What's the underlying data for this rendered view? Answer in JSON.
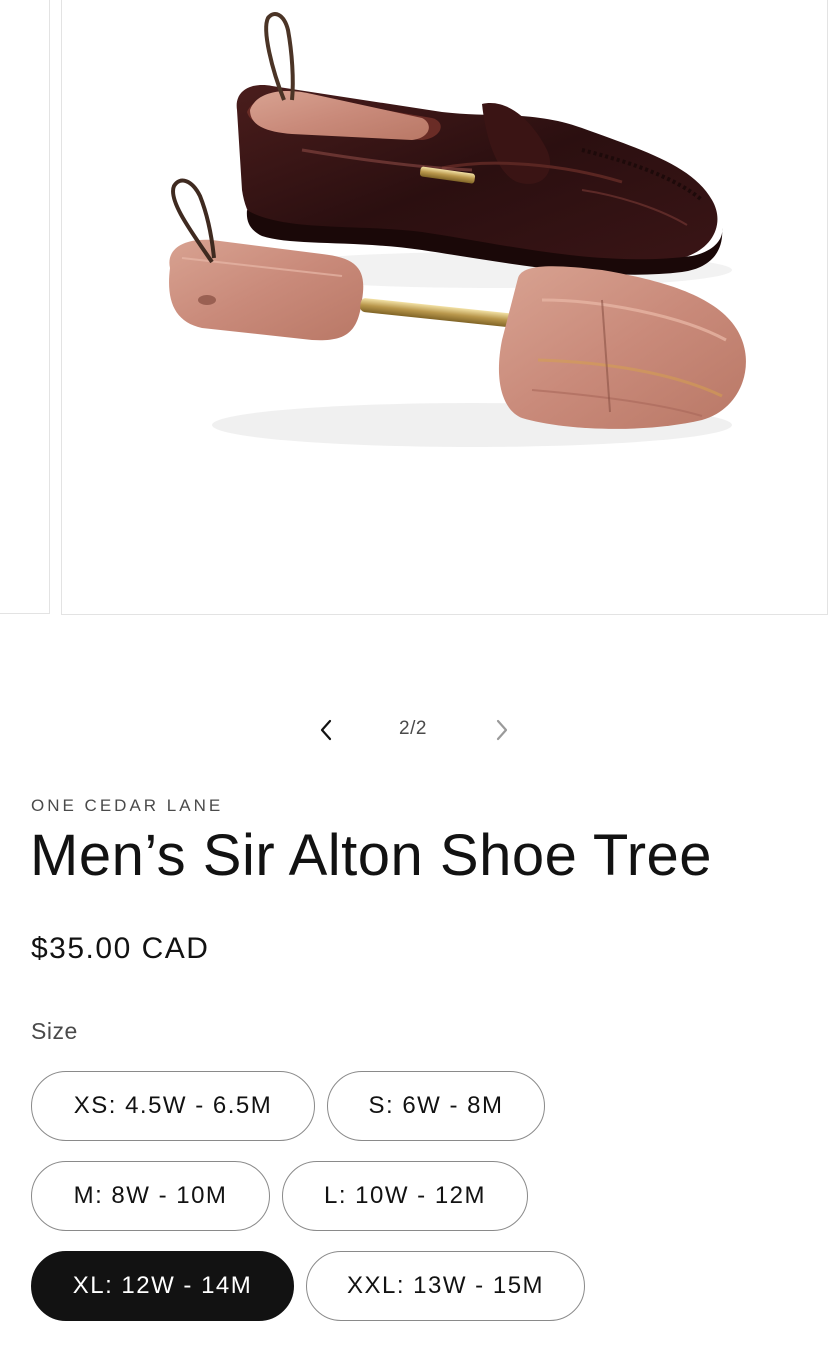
{
  "gallery": {
    "counter": "2/2",
    "image_alt": "Men’s Sir Alton Shoe Tree",
    "prev_icon": "chevron-left-icon",
    "next_icon": "chevron-right-icon"
  },
  "product": {
    "vendor": "ONE CEDAR LANE",
    "title": "Men’s Sir Alton Shoe Tree",
    "price": "$35.00 CAD"
  },
  "variants": {
    "label": "Size",
    "options": [
      {
        "label": "XS: 4.5W - 6.5M",
        "selected": false
      },
      {
        "label": "S: 6W - 8M",
        "selected": false
      },
      {
        "label": "M: 8W - 10M",
        "selected": false
      },
      {
        "label": "L: 10W - 12M",
        "selected": false
      },
      {
        "label": "XL: 12W - 14M",
        "selected": true
      },
      {
        "label": "XXL: 13W - 15M",
        "selected": false
      }
    ]
  },
  "colors": {
    "text": "#121212",
    "muted": "#4a4a4a",
    "border": "#8a8a8a",
    "selected_bg": "#121212"
  }
}
